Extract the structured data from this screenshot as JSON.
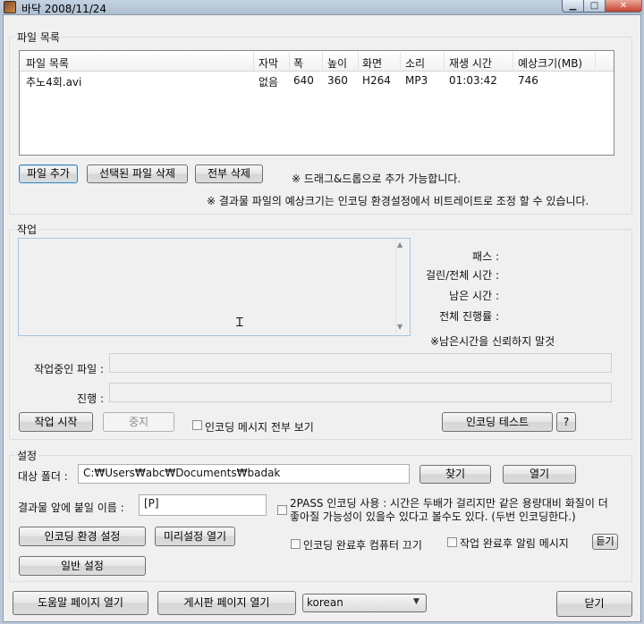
{
  "window": {
    "title": "바닥 2008/11/24",
    "min": "▁",
    "max": "□",
    "close": "✕"
  },
  "files": {
    "group_label": "파일 목록",
    "columns": [
      "파일 목록",
      "자막",
      "폭",
      "높이",
      "화면",
      "소리",
      "재생 시간",
      "예상크기(MB)"
    ],
    "rows": [
      [
        "추노4회.avi",
        "없음",
        "640",
        "360",
        "H264",
        "MP3",
        "01:03:42",
        "746"
      ]
    ],
    "add_button": "파일 추가",
    "delete_selected_button": "선택된 파일 삭제",
    "delete_all_button": "전부 삭제",
    "drag_hint": "※ 드래그&드롭으로 추가 가능합니다.",
    "size_hint": "※ 결과물 파일의 예상크기는 인코딩 환경설정에서 비트레이트로 조정 할 수 있습니다."
  },
  "task": {
    "group_label": "작업",
    "pass_label": "패스 :",
    "elapsed_label": "걸린/전체 시간 :",
    "remaining_label": "남은 시간 :",
    "total_progress_label": "전체 진행률 :",
    "remaining_note": "※남은시간을 신뢰하지 말것",
    "current_file_label": "작업중인 파일 :",
    "current_file_value": "",
    "progress_label": "진행 :",
    "progress_value": 0,
    "start_button": "작업 시작",
    "stop_button": "중지",
    "show_all_messages_label": "인코딩 메시지 전부 보기",
    "show_all_messages_checked": false,
    "encoding_test_button": "인코딩 테스트",
    "help_button": "?"
  },
  "settings": {
    "group_label": "설정",
    "target_folder_label": "대상 폴더 :",
    "target_folder_value": "C:₩Users₩abc₩Documents₩badak",
    "browse_button": "찾기",
    "open_button": "열기",
    "prefix_label": "결과물 앞에 붙일 이름 :",
    "prefix_value": "[P]",
    "twopass_label": "2PASS 인코딩 사용 : 시간은 두배가 걸리지만 같은 용량대비 화질이 더 좋아질 가능성이 있을수 있다고 볼수도 있다. (두번 인코딩한다.)",
    "twopass_checked": false,
    "encoding_settings_button": "인코딩 환경 설정",
    "preset_open_button": "미리설정 열기",
    "shutdown_label": "인코딩 완료후 컴퓨터 끄기",
    "shutdown_checked": false,
    "alarm_label": "작업 완료후 알림 메시지",
    "alarm_checked": false,
    "listen_button": "듣기",
    "general_settings_button": "일반 설정"
  },
  "bottom": {
    "help_page_button": "도움말 페이지 열기",
    "board_page_button": "게시판 페이지 열기",
    "language_value": "korean",
    "close_button": "닫기"
  }
}
